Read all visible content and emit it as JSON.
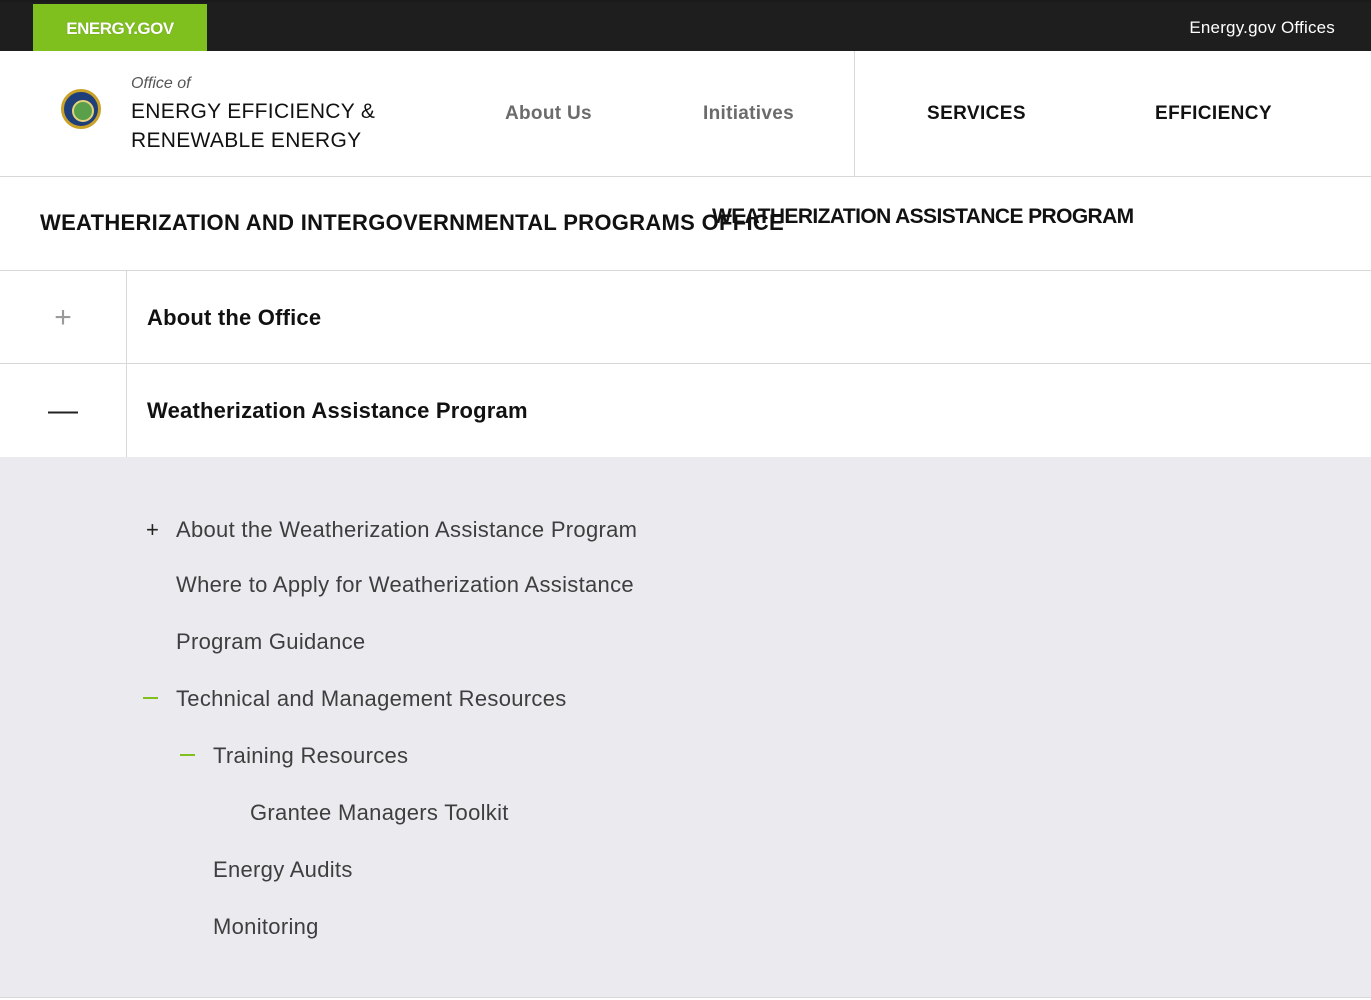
{
  "topbar": {
    "brand": "ENERGY.GOV",
    "offices_link": "Energy.gov Offices"
  },
  "header": {
    "office_of": "Office of",
    "office_name": "ENERGY EFFICIENCY & RENEWABLE ENERGY",
    "nav": {
      "about": "About Us",
      "initiatives": "Initiatives",
      "services": "SERVICES",
      "efficiency": "EFFICIENCY"
    }
  },
  "section": {
    "title": "WEATHERIZATION AND INTERGOVERNMENTAL PROGRAMS OFFICE",
    "overlay_title": "WEATHERIZATION ASSISTANCE PROGRAM"
  },
  "accordion": [
    {
      "toggle": "+",
      "label": "About the Office"
    },
    {
      "toggle": "—",
      "label": "Weatherization Assistance Program"
    }
  ],
  "submenu": [
    {
      "marker": "+",
      "label": "About the Weatherization Assistance Program"
    },
    {
      "marker": "",
      "label": "Where to Apply for Weatherization Assistance"
    },
    {
      "marker": "",
      "label": "Program Guidance"
    },
    {
      "marker": "—",
      "label": "Technical and Management Resources"
    },
    {
      "marker": "—",
      "label": "Training Resources"
    },
    {
      "marker": "",
      "label": "Grantee Managers Toolkit"
    },
    {
      "marker": "",
      "label": "Energy Audits"
    },
    {
      "marker": "",
      "label": "Monitoring"
    }
  ],
  "colors": {
    "brand_green": "#7fbf1e",
    "topbar_bg": "#1e1e1e",
    "panel_bg": "#ebebef"
  }
}
